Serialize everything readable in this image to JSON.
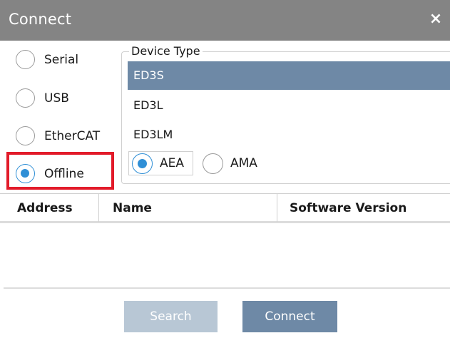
{
  "window": {
    "title": "Connect",
    "close_glyph": "×"
  },
  "connection_types": [
    {
      "label": "Serial",
      "selected": false
    },
    {
      "label": "USB",
      "selected": false
    },
    {
      "label": "EtherCAT",
      "selected": false
    },
    {
      "label": "Offline",
      "selected": true
    }
  ],
  "device_type": {
    "legend": "Device Type",
    "items": [
      "ED3S",
      "ED3L",
      "ED3LM"
    ],
    "selected_index": 0,
    "variants": [
      {
        "label": "AEA",
        "selected": true
      },
      {
        "label": "AMA",
        "selected": false
      }
    ]
  },
  "table": {
    "columns": [
      "Address",
      "Name",
      "Software Version"
    ],
    "rows": []
  },
  "buttons": {
    "search": "Search",
    "connect": "Connect"
  },
  "colors": {
    "titlebar": "#848484",
    "selected_row": "#6e89a6",
    "radio_accent": "#2f8fd6",
    "highlight_box": "#e21b2a",
    "search_disabled": "#b8c7d5"
  }
}
